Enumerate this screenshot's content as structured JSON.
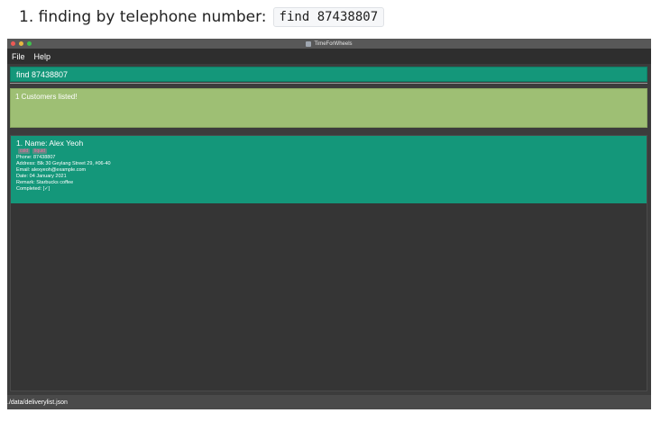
{
  "caption": {
    "text": "1. finding by telephone number:",
    "code": "find 87438807"
  },
  "window": {
    "title": "TimeForWheels",
    "app_icon": "app-icon",
    "controls": {
      "close_color": "#ec5a55",
      "minimize_color": "#e6b740",
      "zoom_color": "#3fc24d"
    }
  },
  "menu": {
    "items": [
      "File",
      "Help"
    ]
  },
  "command_box": {
    "value": "find 87438807"
  },
  "result_display": {
    "text": "1 Customers listed!"
  },
  "customers": [
    {
      "index_name": "1.  Name: Alex Yeoh",
      "tags": [
        "cold",
        "liquid"
      ],
      "phone": "Phone: 87438807",
      "address": "Address: Blk 30 Geylang Street 29, #06-40",
      "email": "Email: alexyeoh@example.com",
      "date": "Date: 04 January 2021",
      "remark": "Remark: Starbucks coffee",
      "completed": "Completed: [✓]"
    }
  ],
  "status_bar": {
    "path": "./data/deliverylist.json"
  },
  "colors": {
    "accent_green": "#14977a",
    "result_green": "#9ebf74",
    "background": "#3c3c3c",
    "tag_text": "#ff6aa0"
  }
}
